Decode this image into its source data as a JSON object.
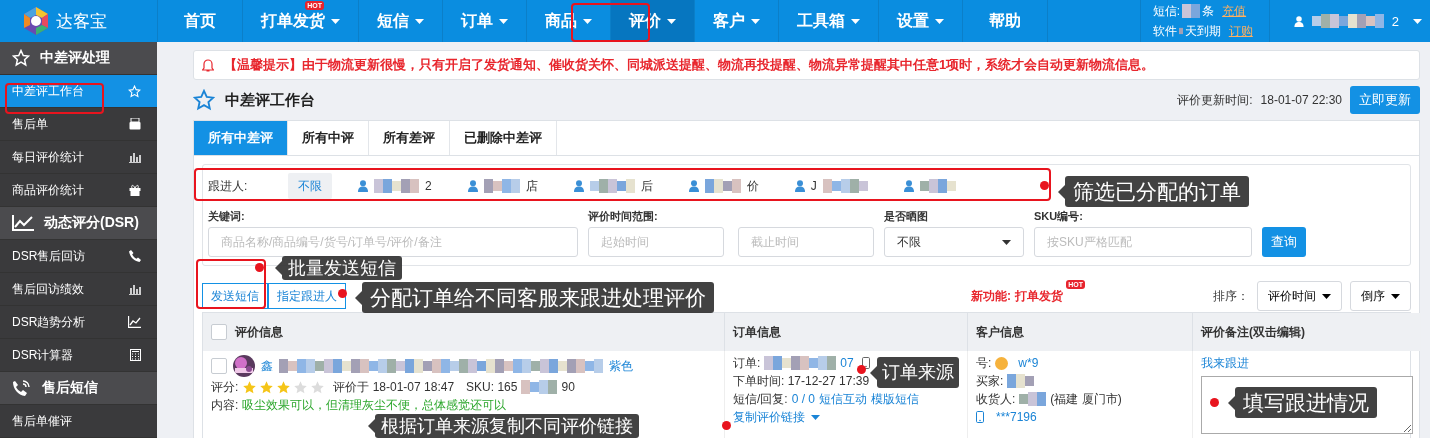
{
  "header": {
    "logo": "达客宝",
    "nav": [
      {
        "label": "首页",
        "dropdown": false,
        "selected": false
      },
      {
        "label": "打单发货",
        "dropdown": true,
        "badge": "HOT",
        "selected": false
      },
      {
        "label": "短信",
        "dropdown": true,
        "selected": false
      },
      {
        "label": "订单",
        "dropdown": true,
        "selected": false
      },
      {
        "label": "商品",
        "dropdown": true,
        "selected": false
      },
      {
        "label": "评价",
        "dropdown": true,
        "selected": true
      },
      {
        "label": "客户",
        "dropdown": true,
        "selected": false
      },
      {
        "label": "工具箱",
        "dropdown": true,
        "selected": false
      },
      {
        "label": "设置",
        "dropdown": true,
        "selected": false
      },
      {
        "label": "帮助",
        "dropdown": false,
        "selected": false
      }
    ],
    "sms_label": "短信:",
    "sms_unit": "条",
    "recharge": "充值",
    "software_label": "软件",
    "expiry": "天到期",
    "order_link": "订购",
    "user_suffix": "2"
  },
  "sidebar": [
    {
      "title": "中差评处理",
      "items": [
        {
          "label": "中差评工作台",
          "selected": true
        },
        {
          "label": "售后单",
          "selected": false
        },
        {
          "label": "每日评价统计",
          "selected": false
        },
        {
          "label": "商品评价统计",
          "selected": false
        }
      ]
    },
    {
      "title": "动态评分(DSR)",
      "items": [
        {
          "label": "DSR售后回访",
          "selected": false
        },
        {
          "label": "售后回访绩效",
          "selected": false
        },
        {
          "label": "DSR趋势分析",
          "selected": false
        },
        {
          "label": "DSR计算器",
          "selected": false
        }
      ]
    },
    {
      "title": "售后短信",
      "items": [
        {
          "label": "售后单催评",
          "selected": false
        }
      ]
    }
  ],
  "notice": "【温馨提示】由于物流更新很慢，只有开启了发货通知、催收货关怀、同城派送提醒、物流再投提醒、物流异常提醒其中任意1项时，系统才会自动更新物流信息。",
  "page_title": "中差评工作台",
  "update_label": "评价更新时间:",
  "update_time": "18-01-07 22:30",
  "update_button": "立即更新",
  "tabs": [
    {
      "label": "所有中差评",
      "selected": true
    },
    {
      "label": "所有中评",
      "selected": false
    },
    {
      "label": "所有差评",
      "selected": false
    },
    {
      "label": "已删除中差评",
      "selected": false
    }
  ],
  "follower_filter": {
    "label": "跟进人:",
    "options": [
      {
        "kind": "all",
        "text": "不限",
        "selected": true
      },
      {
        "kind": "person",
        "end": "2",
        "selected": false
      },
      {
        "kind": "person",
        "end": "店",
        "selected": false
      },
      {
        "kind": "person",
        "end": "后",
        "selected": false
      },
      {
        "kind": "person",
        "end": "价",
        "selected": false
      },
      {
        "kind": "person",
        "start": "J",
        "selected": false
      },
      {
        "kind": "person",
        "selected": false
      }
    ]
  },
  "form": [
    {
      "label": "关键词:",
      "kind": "text",
      "placeholder": "商品名称/商品编号/货号/订单号/评价/备注"
    },
    {
      "label": "评价时间范围:",
      "kind": "range",
      "placeholder": "起始时间",
      "placeholder2": "截止时间"
    },
    {
      "label": "是否晒图",
      "kind": "select",
      "value": "不限"
    },
    {
      "label": "SKU编号:",
      "kind": "text",
      "placeholder": "按SKU严格匹配"
    }
  ],
  "search_button": "查询",
  "actions": [
    "发送短信",
    "指定跟进人"
  ],
  "new_feature_label": "新功能:",
  "new_feature_link": "打单发货",
  "new_feature_badge": "HOT",
  "sort_label": "排序：",
  "sort_field": "评价时间",
  "sort_order": "倒序",
  "table": {
    "select_all_checked": false,
    "columns": [
      "评价信息",
      "订单信息",
      "客户信息",
      "评价备注(双击编辑)"
    ],
    "rows": [
      {
        "checked": false,
        "product_start": "鑫",
        "product_end": "紫色",
        "rating_label": "评分:",
        "stars": 3,
        "rated_at": "评价于 18-01-07 18:47",
        "sku_label": "SKU: 165",
        "sku_end": "90",
        "content_label": "内容:",
        "content": "吸尘效果可以，但清理灰尘不便，总体感觉还可以",
        "order_label": "订单:",
        "order_end": "07",
        "order_time": "下单时间: 17-12-27 17:39",
        "sms_label": "短信/回复:",
        "sms_count": "0 / 0",
        "sms_interact": "短信互动",
        "sms_template": "模版短信",
        "copy_link": "复制评价链接",
        "buyer_id_label": "号:",
        "buyer_id": "w*9",
        "buyer_label": "买家:",
        "receiver_label": "收货人:",
        "receiver_region": "(福建 厦门市)",
        "phone": "***7196",
        "follow_link": "我来跟进"
      }
    ]
  },
  "annotations": [
    {
      "text": "筛选已分配的订单"
    },
    {
      "text": "批量发送短信"
    },
    {
      "text": "分配订单给不同客服来跟进处理评价"
    },
    {
      "text": "订单来源"
    },
    {
      "text": "根据订单来源复制不同评价链接"
    },
    {
      "text": "填写跟进情况"
    }
  ]
}
